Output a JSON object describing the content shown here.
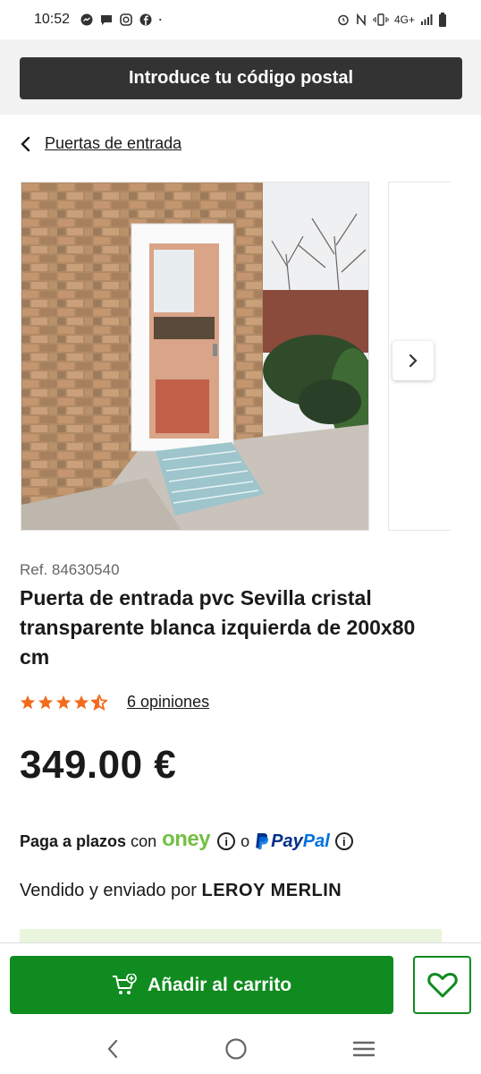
{
  "status": {
    "time": "10:52",
    "network": "4G+",
    "notification_icons": [
      "messenger-icon",
      "chat-icon",
      "instagram-icon",
      "facebook-icon"
    ]
  },
  "header": {
    "postal_button_label": "Introduce tu código postal"
  },
  "breadcrumb": {
    "label": "Puertas de entrada"
  },
  "product": {
    "ref": "Ref. 84630540",
    "title": "Puerta de entrada pvc Sevilla cristal transparente blanca izquierda de 200x80 cm",
    "rating": 4.5,
    "rating_max": 5,
    "reviews_label": "6 opiniones",
    "price": "349.00 €"
  },
  "payment": {
    "pay_label": "Paga a plazos",
    "con_label": "con",
    "oney_label": "oney",
    "or_label": "o",
    "paypal_pay": "Pay",
    "paypal_pal": "Pal"
  },
  "seller": {
    "prefix": "Vendido y enviado por",
    "name": "LEROY MERLIN"
  },
  "actions": {
    "add_to_cart": "Añadir al carrito"
  },
  "colors": {
    "brand_green": "#0f8b1f",
    "star_orange": "#f26b1d",
    "oney_green": "#74c043",
    "dark_button": "#333333"
  }
}
